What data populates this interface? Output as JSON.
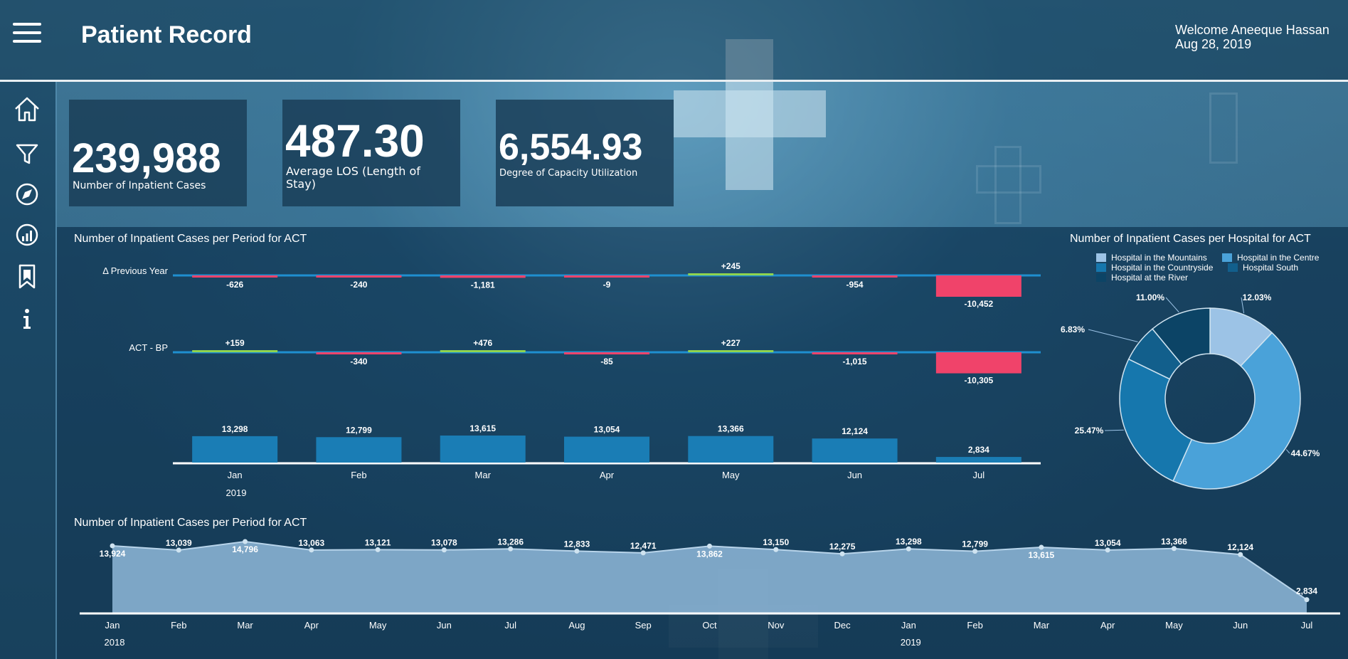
{
  "header": {
    "title": "Patient Record",
    "welcome": "Welcome Aneeque Hassan",
    "date": "Aug 28, 2019"
  },
  "sidebar": {
    "items": [
      {
        "icon": "home-icon"
      },
      {
        "icon": "filter-icon"
      },
      {
        "icon": "compass-icon"
      },
      {
        "icon": "chart-icon"
      },
      {
        "icon": "bookmark-icon"
      },
      {
        "icon": "info-icon"
      }
    ]
  },
  "kpis": [
    {
      "value": "239,988",
      "label": "Number of Inpatient Cases"
    },
    {
      "value": "487.30",
      "label": "Average LOS (Length of Stay)"
    },
    {
      "value": "6,554.93",
      "label": "Degree of Capacity Utilization"
    }
  ],
  "colors": {
    "bar": "#1a7db5",
    "negative": "#f0436a",
    "positive": "#8fd44f",
    "baseline": "#1f8fd0",
    "area": "#8fb9d9"
  },
  "chart_data": [
    {
      "type": "bar",
      "title": "Number of Inpatient Cases per Period for ACT",
      "categories": [
        "Jan",
        "Feb",
        "Mar",
        "Apr",
        "May",
        "Jun",
        "Jul"
      ],
      "year_label": "2019",
      "series": [
        {
          "values": [
            13298,
            12799,
            13615,
            13054,
            13366,
            12124,
            2834
          ]
        }
      ],
      "value_labels": [
        "13,298",
        "12,799",
        "13,615",
        "13,054",
        "13,366",
        "12,124",
        "2,834"
      ],
      "variances": [
        {
          "name": "Δ Previous Year",
          "values": [
            -626,
            -240,
            -1181,
            -9,
            245,
            -954,
            -10452
          ],
          "labels": [
            "-626",
            "-240",
            "-1,181",
            "-9",
            "+245",
            "-954",
            "-10,452"
          ]
        },
        {
          "name": "ACT - BP",
          "values": [
            159,
            -340,
            476,
            -85,
            227,
            -1015,
            -10305
          ],
          "labels": [
            "+159",
            "-340",
            "+476",
            "-85",
            "+227",
            "-1,015",
            "-10,305"
          ]
        }
      ]
    },
    {
      "type": "pie",
      "title": "Number of Inpatient Cases per Hospital for ACT",
      "legend": [
        "Hospital in the Mountains",
        "Hospital in the Centre",
        "Hospital in the Countryside",
        "Hospital South",
        "Hospital at the River"
      ],
      "slices": [
        {
          "name": "Hospital in the Mountains",
          "value": 12.03,
          "label": "12.03%",
          "color": "#9cc3e6"
        },
        {
          "name": "Hospital in the Centre",
          "value": 44.67,
          "label": "44.67%",
          "color": "#4aa2d9"
        },
        {
          "name": "Hospital in the Countryside",
          "value": 25.47,
          "label": "25.47%",
          "color": "#1677ad"
        },
        {
          "name": "Hospital South",
          "value": 6.83,
          "label": "6.83%",
          "color": "#125f8c"
        },
        {
          "name": "Hospital at the River",
          "value": 11.0,
          "label": "11.00%",
          "color": "#0c4466"
        }
      ]
    },
    {
      "type": "area",
      "title": "Number of Inpatient Cases per Period for ACT",
      "categories": [
        "Jan",
        "Feb",
        "Mar",
        "Apr",
        "May",
        "Jun",
        "Jul",
        "Aug",
        "Sep",
        "Oct",
        "Nov",
        "Dec",
        "Jan",
        "Feb",
        "Mar",
        "Apr",
        "May",
        "Jun",
        "Jul"
      ],
      "year_labels": [
        {
          "index": 0,
          "label": "2018"
        },
        {
          "index": 12,
          "label": "2019"
        }
      ],
      "values": [
        13924,
        13039,
        14796,
        13063,
        13121,
        13078,
        13286,
        12833,
        12471,
        13862,
        13150,
        12275,
        13298,
        12799,
        13615,
        13054,
        13366,
        12124,
        2834
      ],
      "value_labels": [
        "13,924",
        "13,039",
        "14,796",
        "13,063",
        "13,121",
        "13,078",
        "13,286",
        "12,833",
        "12,471",
        "13,862",
        "13,150",
        "12,275",
        "13,298",
        "12,799",
        "13,615",
        "13,054",
        "13,366",
        "12,124",
        "2,834"
      ]
    }
  ]
}
